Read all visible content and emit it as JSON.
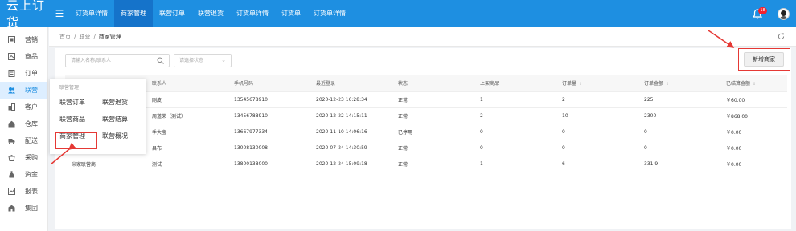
{
  "app": {
    "logo": "云上订货"
  },
  "top_tabs": [
    {
      "label": "订货单详情"
    },
    {
      "label": "商家管理"
    },
    {
      "label": "联营订单"
    },
    {
      "label": "联营退货"
    },
    {
      "label": "订货单详情"
    },
    {
      "label": "订货单"
    },
    {
      "label": "订货单详情"
    }
  ],
  "notifications": {
    "count": "18"
  },
  "sidebar": [
    {
      "label": "营销",
      "icon": "marketing-icon"
    },
    {
      "label": "商品",
      "icon": "product-icon"
    },
    {
      "label": "订单",
      "icon": "order-icon"
    },
    {
      "label": "联营",
      "icon": "alliance-icon"
    },
    {
      "label": "客户",
      "icon": "customer-icon"
    },
    {
      "label": "仓库",
      "icon": "warehouse-icon"
    },
    {
      "label": "配送",
      "icon": "delivery-icon"
    },
    {
      "label": "采购",
      "icon": "purchase-icon"
    },
    {
      "label": "资金",
      "icon": "funds-icon"
    },
    {
      "label": "报表",
      "icon": "report-icon"
    },
    {
      "label": "集团",
      "icon": "group-icon"
    }
  ],
  "breadcrumb": {
    "home": "首页",
    "level1": "联营",
    "current": "商家管理"
  },
  "filters": {
    "search_placeholder": "请输入名称/联系人",
    "status_placeholder": "请选择状态"
  },
  "add_button": "新增商家",
  "table": {
    "headers": [
      "联系人",
      "手机号码",
      "最近登录",
      "状态",
      "上架商品",
      "订单量",
      "订单金额",
      "已结算金额"
    ],
    "rows": [
      [
        "",
        "刚皮",
        "13545678910",
        "2020-12-23 16:28:34",
        "正常",
        "1",
        "2",
        "225",
        "￥60.00"
      ],
      [
        "",
        "周道荣（测试）",
        "13456788910",
        "2020-12-22 14:15:11",
        "正常",
        "2",
        "10",
        "2300",
        "￥868.00"
      ],
      [
        "",
        "季大宝",
        "13667977334",
        "2020-11-10 14:06:16",
        "已停用",
        "0",
        "0",
        "0",
        "￥0.00"
      ],
      [
        "",
        "吕布",
        "13008130008",
        "2020-07-24 14:30:59",
        "正常",
        "0",
        "0",
        "0",
        "￥0.00"
      ],
      [
        "米家联营商",
        "测试",
        "13800138000",
        "2020-12-24 15:09:18",
        "正常",
        "1",
        "6",
        "331.9",
        "￥0.00"
      ]
    ]
  },
  "flyout": {
    "title": "联营管理",
    "items": [
      "联营订单",
      "联营退货",
      "联营商品",
      "联营结算",
      "商家管理",
      "联营概况"
    ]
  }
}
